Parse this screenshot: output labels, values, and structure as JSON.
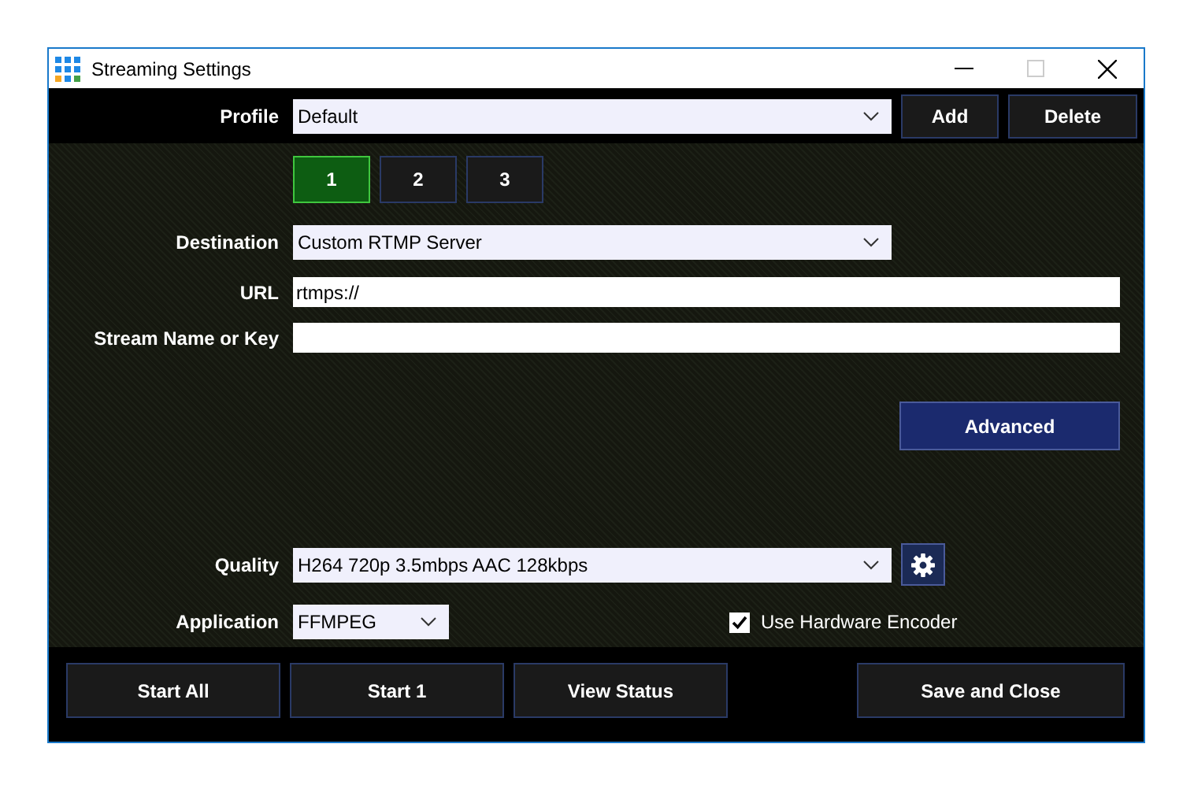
{
  "window": {
    "title": "Streaming Settings"
  },
  "profile": {
    "label": "Profile",
    "value": "Default",
    "actions": [
      "Add",
      "Delete"
    ]
  },
  "tabs": [
    {
      "label": "1",
      "selected": true
    },
    {
      "label": "2",
      "selected": false
    },
    {
      "label": "3",
      "selected": false
    }
  ],
  "fields": [
    {
      "label": "Destination",
      "kind": "select",
      "value": "Custom RTMP Server"
    },
    {
      "label": "URL",
      "kind": "text",
      "value": "rtmps://"
    },
    {
      "label": "Stream Name or Key",
      "kind": "text"
    }
  ],
  "advanced_button": "Advanced",
  "quality": {
    "label": "Quality",
    "value": "H264 720p 3.5mbps AAC 128kbps"
  },
  "application": {
    "label": "Application",
    "value": "FFMPEG"
  },
  "hardware_encoder": {
    "label": "Use Hardware Encoder",
    "checked": true
  },
  "footer_buttons": [
    {
      "label": "Start All",
      "kind": "left"
    },
    {
      "label": "Start 1",
      "kind": "left"
    },
    {
      "label": "View Status",
      "kind": "left"
    },
    {
      "label": "Save and Close",
      "kind": "right"
    }
  ]
}
